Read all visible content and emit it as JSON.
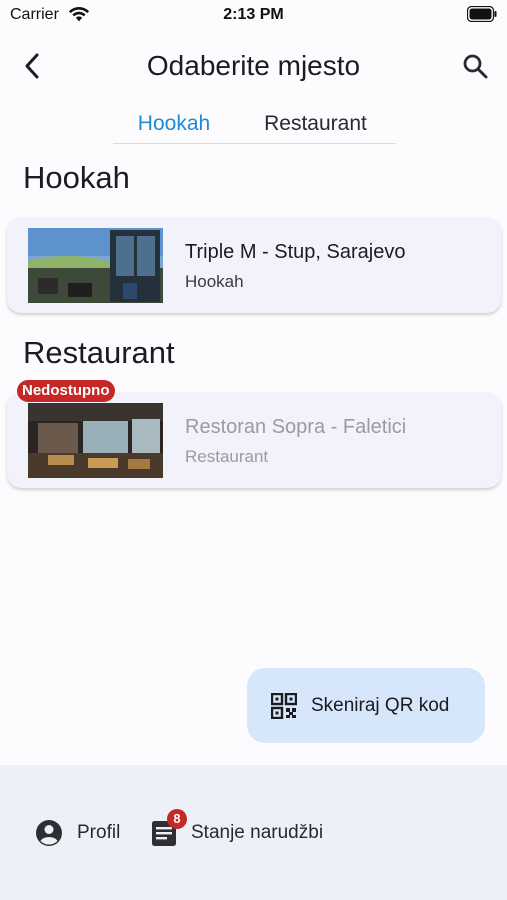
{
  "status_bar": {
    "carrier": "Carrier",
    "time": "2:13 PM"
  },
  "header": {
    "title": "Odaberite mjesto",
    "back_icon": "chevron-left-icon",
    "search_icon": "search-icon"
  },
  "tabs": [
    {
      "label": "Hookah",
      "active": true
    },
    {
      "label": "Restaurant",
      "active": false
    }
  ],
  "sections": [
    {
      "heading": "Hookah",
      "items": [
        {
          "title": "Triple M - Stup, Sarajevo",
          "category": "Hookah",
          "available": true
        }
      ]
    },
    {
      "heading": "Restaurant",
      "items": [
        {
          "title": "Restoran Sopra - Faletici",
          "category": "Restaurant",
          "available": false,
          "badge": "Nedostupno"
        }
      ]
    }
  ],
  "fab": {
    "label": "Skeniraj QR kod",
    "icon": "qr-code-icon"
  },
  "bottom_nav": {
    "profile_label": "Profil",
    "orders_label": "Stanje narudžbi",
    "orders_badge": "8"
  },
  "colors": {
    "accent": "#1f8ad6",
    "badge": "#c62828",
    "fab": "#d6e6fb",
    "card": "#f2f3fa"
  }
}
